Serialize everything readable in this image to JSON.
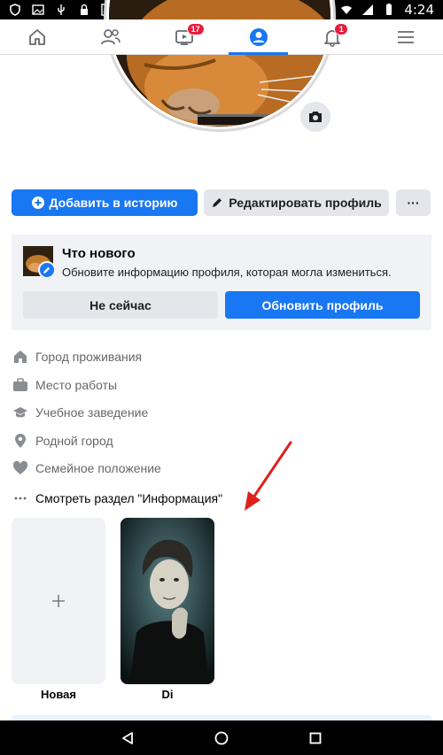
{
  "statusbar": {
    "time": "4:24"
  },
  "nav": {
    "tabs": [
      {
        "icon": "home-icon"
      },
      {
        "icon": "friends-icon"
      },
      {
        "icon": "video-icon",
        "badge": "17"
      },
      {
        "icon": "profile-icon"
      },
      {
        "icon": "bell-icon",
        "badge": "1"
      },
      {
        "icon": "menu-icon"
      }
    ]
  },
  "profile": {
    "add_story_label": "Добавить в историю",
    "edit_profile_label": "Редактировать профиль",
    "more_label": "···"
  },
  "whats_new": {
    "title": "Что нового",
    "description": "Обновите информацию профиля, которая могла измениться.",
    "not_now_label": "Не сейчас",
    "update_label": "Обновить профиль"
  },
  "info": {
    "items": [
      {
        "icon": "home-icon",
        "label": "Город проживания"
      },
      {
        "icon": "briefcase-icon",
        "label": "Место работы"
      },
      {
        "icon": "graduation-cap-icon",
        "label": "Учебное заведение"
      },
      {
        "icon": "location-pin-icon",
        "label": "Родной город"
      },
      {
        "icon": "heart-icon",
        "label": "Семейное положение"
      }
    ],
    "see_more_label": "Смотреть раздел \"Информация\""
  },
  "stories": [
    {
      "label": "Новая"
    },
    {
      "label": "Di"
    }
  ],
  "colors": {
    "accent": "#1877f2",
    "badge": "#e41e3f",
    "annotation_arrow": "#e0201c"
  }
}
